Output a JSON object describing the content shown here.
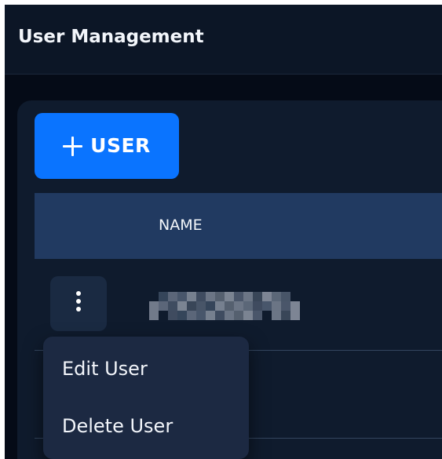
{
  "header": {
    "title": "User Management"
  },
  "toolbar": {
    "add_user_label": "USER",
    "add_user_icon": "plus-icon"
  },
  "table": {
    "columns": [
      {
        "label": "NAME"
      }
    ],
    "rows": [
      {
        "name": "",
        "name_redacted": true,
        "actions_icon": "kebab-icon"
      }
    ]
  },
  "context_menu": {
    "items": [
      {
        "label": "Edit User"
      },
      {
        "label": "Delete User"
      }
    ]
  },
  "colors": {
    "app_background": "#050b17",
    "header_background": "#0c1626",
    "card_background": "#0f1b2d",
    "accent": "#0a74ff",
    "table_header_background": "#213a61",
    "menu_background": "#1c2942",
    "text": "#f3f6fb"
  }
}
